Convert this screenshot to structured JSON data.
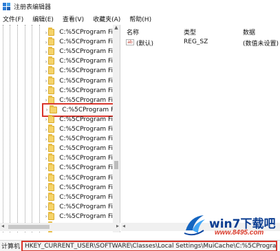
{
  "window": {
    "title": "注册表编辑器"
  },
  "menu": [
    "文件(F)",
    "编辑(E)",
    "查看(V)",
    "收藏夹(A)",
    "帮助(H)"
  ],
  "tree": {
    "items": [
      "C:%5CProgram Fi",
      "C:%5CProgram Fi",
      "C:%5CProgram Fi",
      "C:%5CProgram Fi",
      "C:%5CProgram Fi",
      "C:%5CProgram Fi",
      "C:%5CProgram Fi",
      "C:%5CProgram Fi",
      "C:%5CProgram Fi",
      "C:%5CProgram Fi",
      "C:%5CProgram Fi",
      "C:%5CProgram Fi",
      "C:%5CProgram Fi",
      "C:%5CProgram Fi",
      "C:%5CProgram Fi",
      "C:%5CProgram Fi",
      "C:%5CProgram Fi",
      "C:%5CProgram Fi",
      "C:%5CProgram Fi",
      "C:%5CProgram Fi",
      "C:%5CProgram Fi",
      "C:%5CProgram Fi"
    ],
    "selected_index": 8
  },
  "list": {
    "columns": {
      "name": "名称",
      "type": "类型",
      "data": "数据"
    },
    "rows": [
      {
        "icon": "string-value-icon",
        "icon_text": "ab",
        "name": "(默认)",
        "type": "REG_SZ",
        "data": "(数值未设置)"
      }
    ]
  },
  "status": {
    "prefix": "计算机",
    "path": "HKEY_CURRENT_USER\\SOFTWARE\\Classes\\Local Settings\\MuiCache\\C:%5CProgram Files%5C"
  },
  "watermark": {
    "brand": "win7下载吧",
    "url": "www.8495.com"
  },
  "colors": {
    "highlight": "#d9342b",
    "folder": "#f5d36a",
    "brand": "#0b3d91"
  }
}
